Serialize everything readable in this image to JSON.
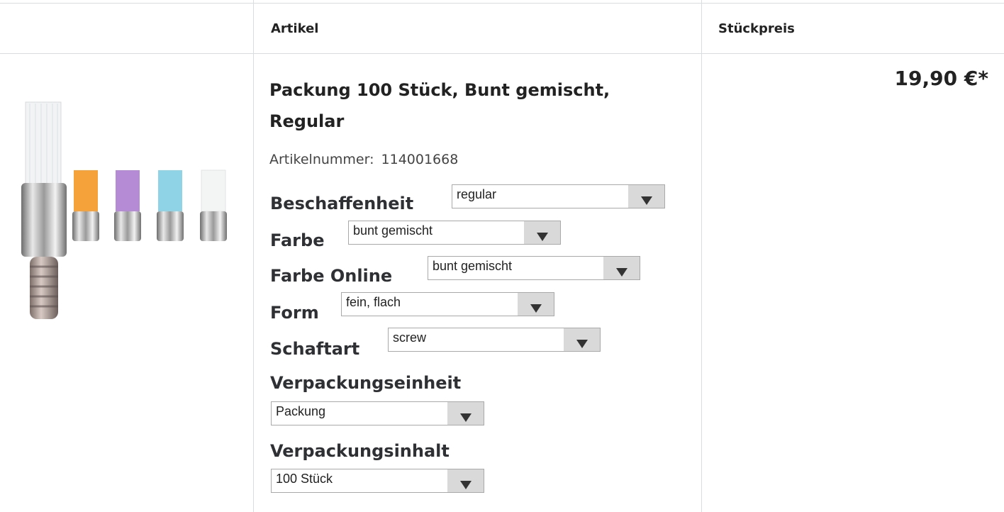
{
  "header": {
    "artikel": "Artikel",
    "stueckpreis": "Stückpreis"
  },
  "product": {
    "title": "Packung 100 Stück, Bunt gemischt, Regular",
    "artikelnummer_label": "Artikelnummer:",
    "artikelnummer": "114001668",
    "price": "19,90 €*",
    "image_icon": "brush-product-image"
  },
  "options": [
    {
      "label": "Beschaffenheit",
      "value": "regular"
    },
    {
      "label": "Farbe",
      "value": "bunt gemischt"
    },
    {
      "label": "Farbe Online",
      "value": "bunt gemischt"
    },
    {
      "label": "Form",
      "value": "fein, flach"
    },
    {
      "label": "Schaftart",
      "value": "screw"
    },
    {
      "label": "Verpackungseinheit",
      "value": "Packung"
    },
    {
      "label": "Verpackungsinhalt",
      "value": "100 Stück"
    }
  ],
  "colors": {
    "border": "#dadde0",
    "select_arrow_bg": "#d9d9d9",
    "brush_orange": "#f5a23a",
    "brush_purple": "#b58bd6",
    "brush_blue": "#8fd3e6",
    "brush_white": "#f3f5f5"
  }
}
